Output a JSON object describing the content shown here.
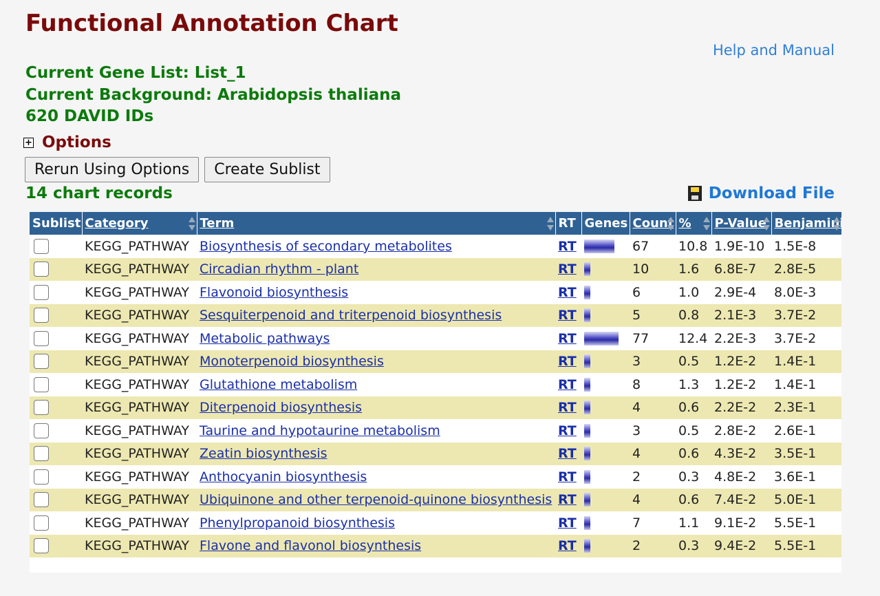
{
  "page": {
    "title": "Functional Annotation Chart",
    "help_link": "Help and Manual",
    "gene_list": "Current Gene List: List_1",
    "background": "Current Background: Arabidopsis thaliana",
    "david_ids": "620 DAVID IDs",
    "options_label": "Options",
    "rerun_button": "Rerun Using Options",
    "sublist_button": "Create Sublist",
    "record_count": "14 chart records",
    "download_label": "Download File"
  },
  "table": {
    "headers": {
      "sublist": "Sublist",
      "category": "Category",
      "term": "Term",
      "rt": "RT",
      "genes": "Genes",
      "count": "Count",
      "percent": "%",
      "pvalue": "P-Value",
      "benjamini": "Benjamini"
    },
    "rt_label": "RT",
    "rows": [
      {
        "category": "KEGG_PATHWAY",
        "term": "Biosynthesis of secondary metabolites",
        "count": "67",
        "percent": "10.8",
        "pvalue": "1.9E-10",
        "benjamini": "1.5E-8"
      },
      {
        "category": "KEGG_PATHWAY",
        "term": "Circadian rhythm - plant",
        "count": "10",
        "percent": "1.6",
        "pvalue": "6.8E-7",
        "benjamini": "2.8E-5"
      },
      {
        "category": "KEGG_PATHWAY",
        "term": "Flavonoid biosynthesis",
        "count": "6",
        "percent": "1.0",
        "pvalue": "2.9E-4",
        "benjamini": "8.0E-3"
      },
      {
        "category": "KEGG_PATHWAY",
        "term": "Sesquiterpenoid and triterpenoid biosynthesis",
        "count": "5",
        "percent": "0.8",
        "pvalue": "2.1E-3",
        "benjamini": "3.7E-2"
      },
      {
        "category": "KEGG_PATHWAY",
        "term": "Metabolic pathways",
        "count": "77",
        "percent": "12.4",
        "pvalue": "2.2E-3",
        "benjamini": "3.7E-2"
      },
      {
        "category": "KEGG_PATHWAY",
        "term": "Monoterpenoid biosynthesis",
        "count": "3",
        "percent": "0.5",
        "pvalue": "1.2E-2",
        "benjamini": "1.4E-1"
      },
      {
        "category": "KEGG_PATHWAY",
        "term": "Glutathione metabolism",
        "count": "8",
        "percent": "1.3",
        "pvalue": "1.2E-2",
        "benjamini": "1.4E-1"
      },
      {
        "category": "KEGG_PATHWAY",
        "term": "Diterpenoid biosynthesis",
        "count": "4",
        "percent": "0.6",
        "pvalue": "2.2E-2",
        "benjamini": "2.3E-1"
      },
      {
        "category": "KEGG_PATHWAY",
        "term": "Taurine and hypotaurine metabolism",
        "count": "3",
        "percent": "0.5",
        "pvalue": "2.8E-2",
        "benjamini": "2.6E-1"
      },
      {
        "category": "KEGG_PATHWAY",
        "term": "Zeatin biosynthesis",
        "count": "4",
        "percent": "0.6",
        "pvalue": "4.3E-2",
        "benjamini": "3.5E-1"
      },
      {
        "category": "KEGG_PATHWAY",
        "term": "Anthocyanin biosynthesis",
        "count": "2",
        "percent": "0.3",
        "pvalue": "4.8E-2",
        "benjamini": "3.6E-1"
      },
      {
        "category": "KEGG_PATHWAY",
        "term": "Ubiquinone and other terpenoid-quinone biosynthesis",
        "count": "4",
        "percent": "0.6",
        "pvalue": "7.4E-2",
        "benjamini": "5.0E-1"
      },
      {
        "category": "KEGG_PATHWAY",
        "term": "Phenylpropanoid biosynthesis",
        "count": "7",
        "percent": "1.1",
        "pvalue": "9.1E-2",
        "benjamini": "5.5E-1"
      },
      {
        "category": "KEGG_PATHWAY",
        "term": "Flavone and flavonol biosynthesis",
        "count": "2",
        "percent": "0.3",
        "pvalue": "9.4E-2",
        "benjamini": "5.5E-1"
      }
    ]
  }
}
